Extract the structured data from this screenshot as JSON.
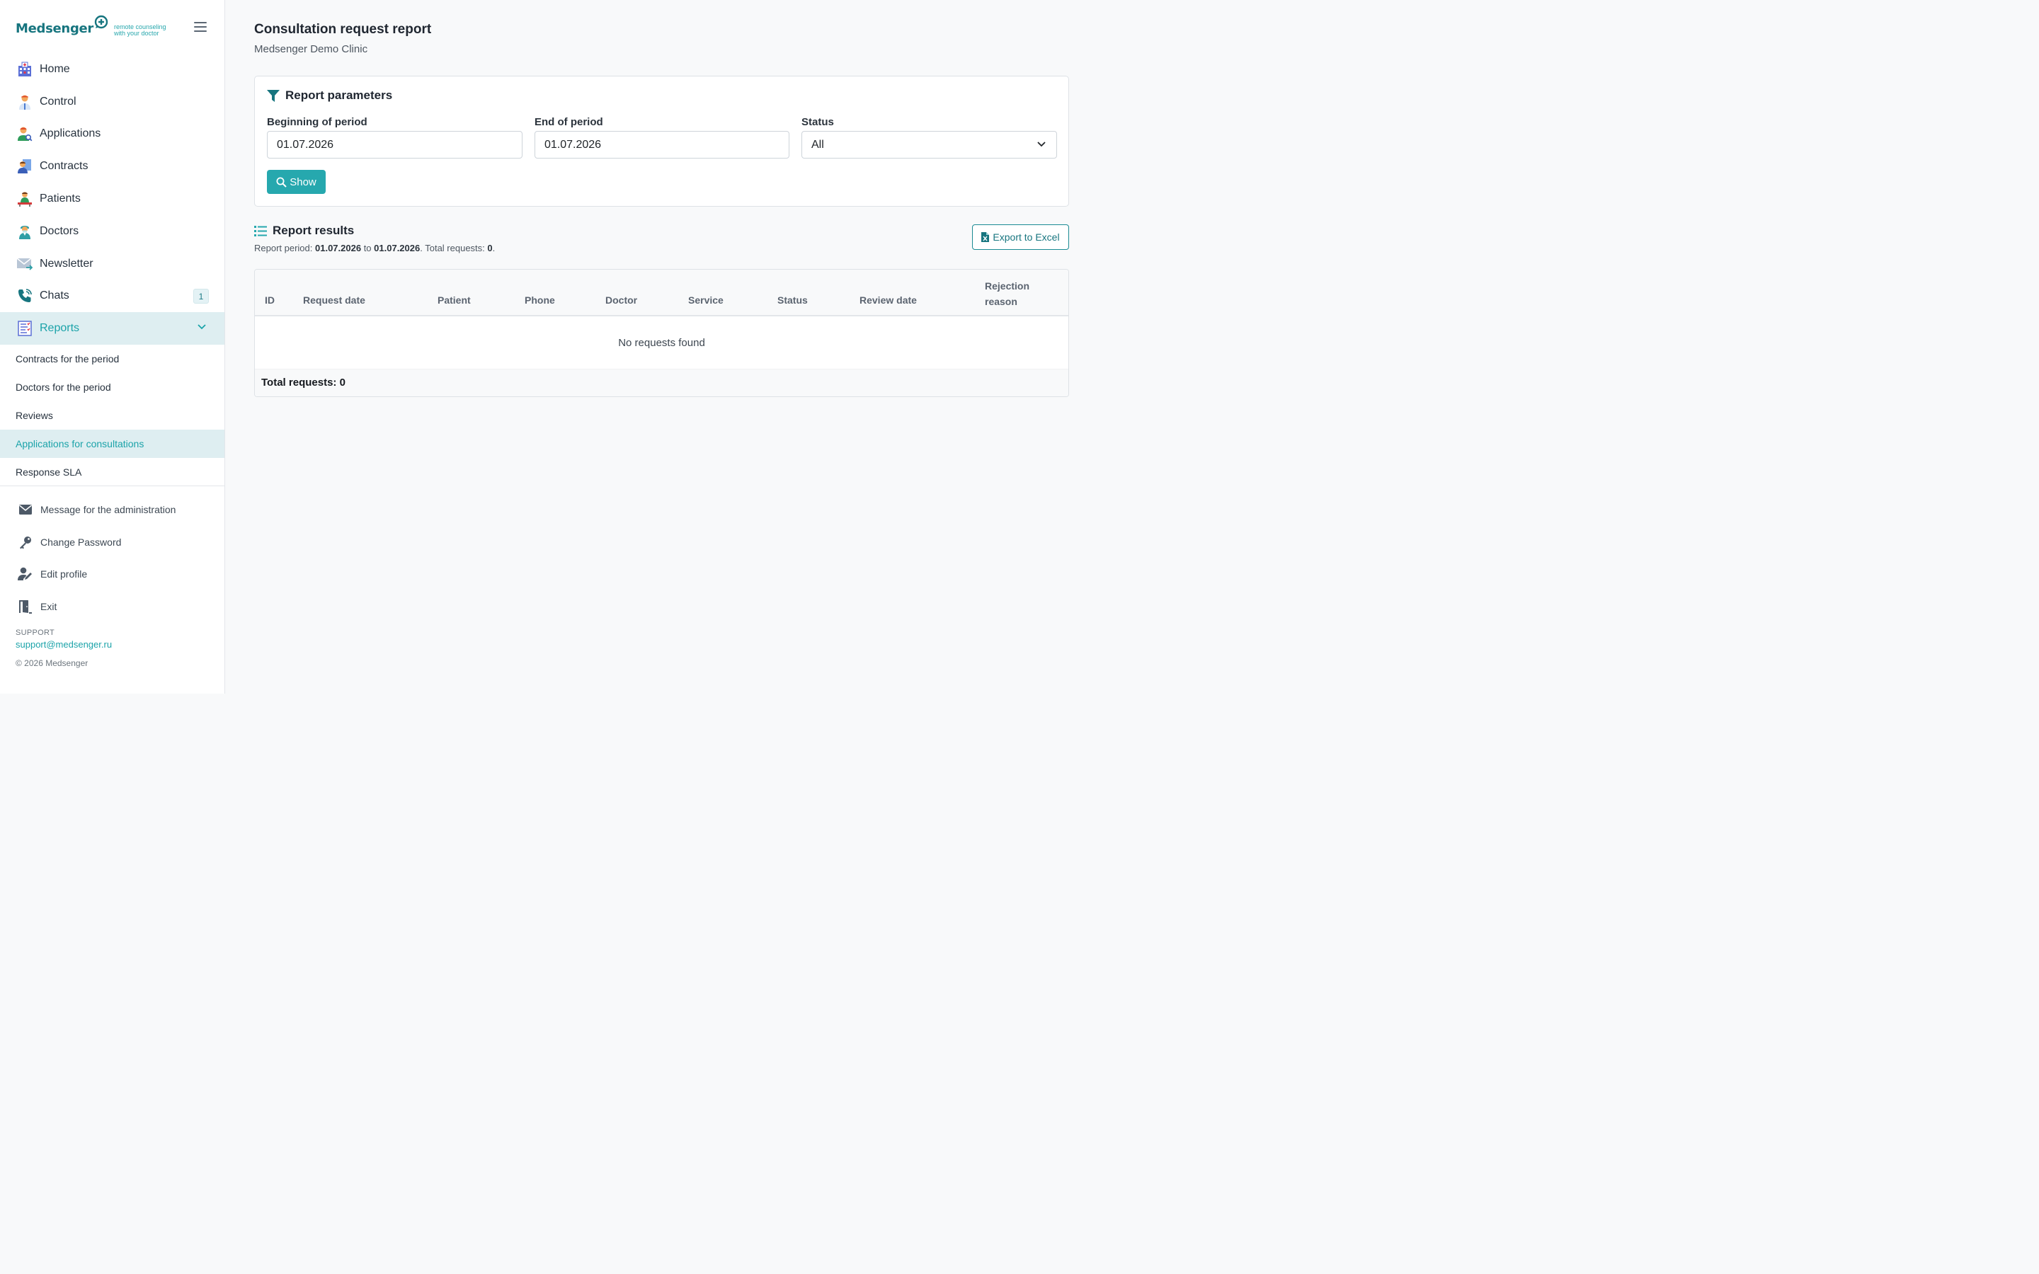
{
  "brand": {
    "name": "Medsenger",
    "tagline_line1": "remote counseling",
    "tagline_line2": "with your doctor"
  },
  "colors": {
    "accent": "#26a8ae",
    "brand_dark": "#17757f",
    "active_bg": "#deeef1"
  },
  "sidebar": {
    "items": [
      {
        "label": "Home",
        "icon": "hospital-icon"
      },
      {
        "label": "Control",
        "icon": "doctor-monitor-icon"
      },
      {
        "label": "Applications",
        "icon": "user-search-icon"
      },
      {
        "label": "Contracts",
        "icon": "contract-user-icon"
      },
      {
        "label": "Patients",
        "icon": "patient-icon"
      },
      {
        "label": "Doctors",
        "icon": "doctor-icon"
      },
      {
        "label": "Newsletter",
        "icon": "envelope-icon"
      },
      {
        "label": "Chats",
        "icon": "phone-icon",
        "badge": "1"
      },
      {
        "label": "Reports",
        "icon": "report-checklist-icon",
        "active": true
      }
    ],
    "reports_subitems": [
      {
        "label": "Contracts for the period"
      },
      {
        "label": "Doctors for the period"
      },
      {
        "label": "Reviews"
      },
      {
        "label": "Applications for consultations",
        "active": true
      },
      {
        "label": "Response SLA"
      }
    ],
    "bottom_items": [
      {
        "label": "Message for the administration",
        "icon": "envelope-icon"
      },
      {
        "label": "Change Password",
        "icon": "key-icon"
      },
      {
        "label": "Edit profile",
        "icon": "user-edit-icon"
      },
      {
        "label": "Exit",
        "icon": "exit-door-icon"
      }
    ],
    "support_label": "SUPPORT",
    "support_email": "support@medsenger.ru",
    "copyright": "© 2026 Medsenger"
  },
  "page": {
    "title": "Consultation request report",
    "subtitle": "Medsenger Demo Clinic"
  },
  "params": {
    "title": "Report parameters",
    "begin_label": "Beginning of period",
    "begin_value": "01.07.2026",
    "end_label": "End of period",
    "end_value": "01.07.2026",
    "status_label": "Status",
    "status_value": "All",
    "show_button": "Show"
  },
  "results": {
    "title": "Report results",
    "period_prefix": "Report period: ",
    "period_from": "01.07.2026",
    "period_to_word": " to ",
    "period_to": "01.07.2026",
    "total_prefix": ". Total requests: ",
    "total_count": "0",
    "total_suffix": ".",
    "export_button": "Export to Excel",
    "columns": [
      "ID",
      "Request date",
      "Patient",
      "Phone",
      "Doctor",
      "Service",
      "Status",
      "Review date"
    ],
    "rejection_line1": "Rejection",
    "rejection_line2": "reason",
    "empty_message": "No requests found",
    "total_row": "Total requests: 0"
  }
}
